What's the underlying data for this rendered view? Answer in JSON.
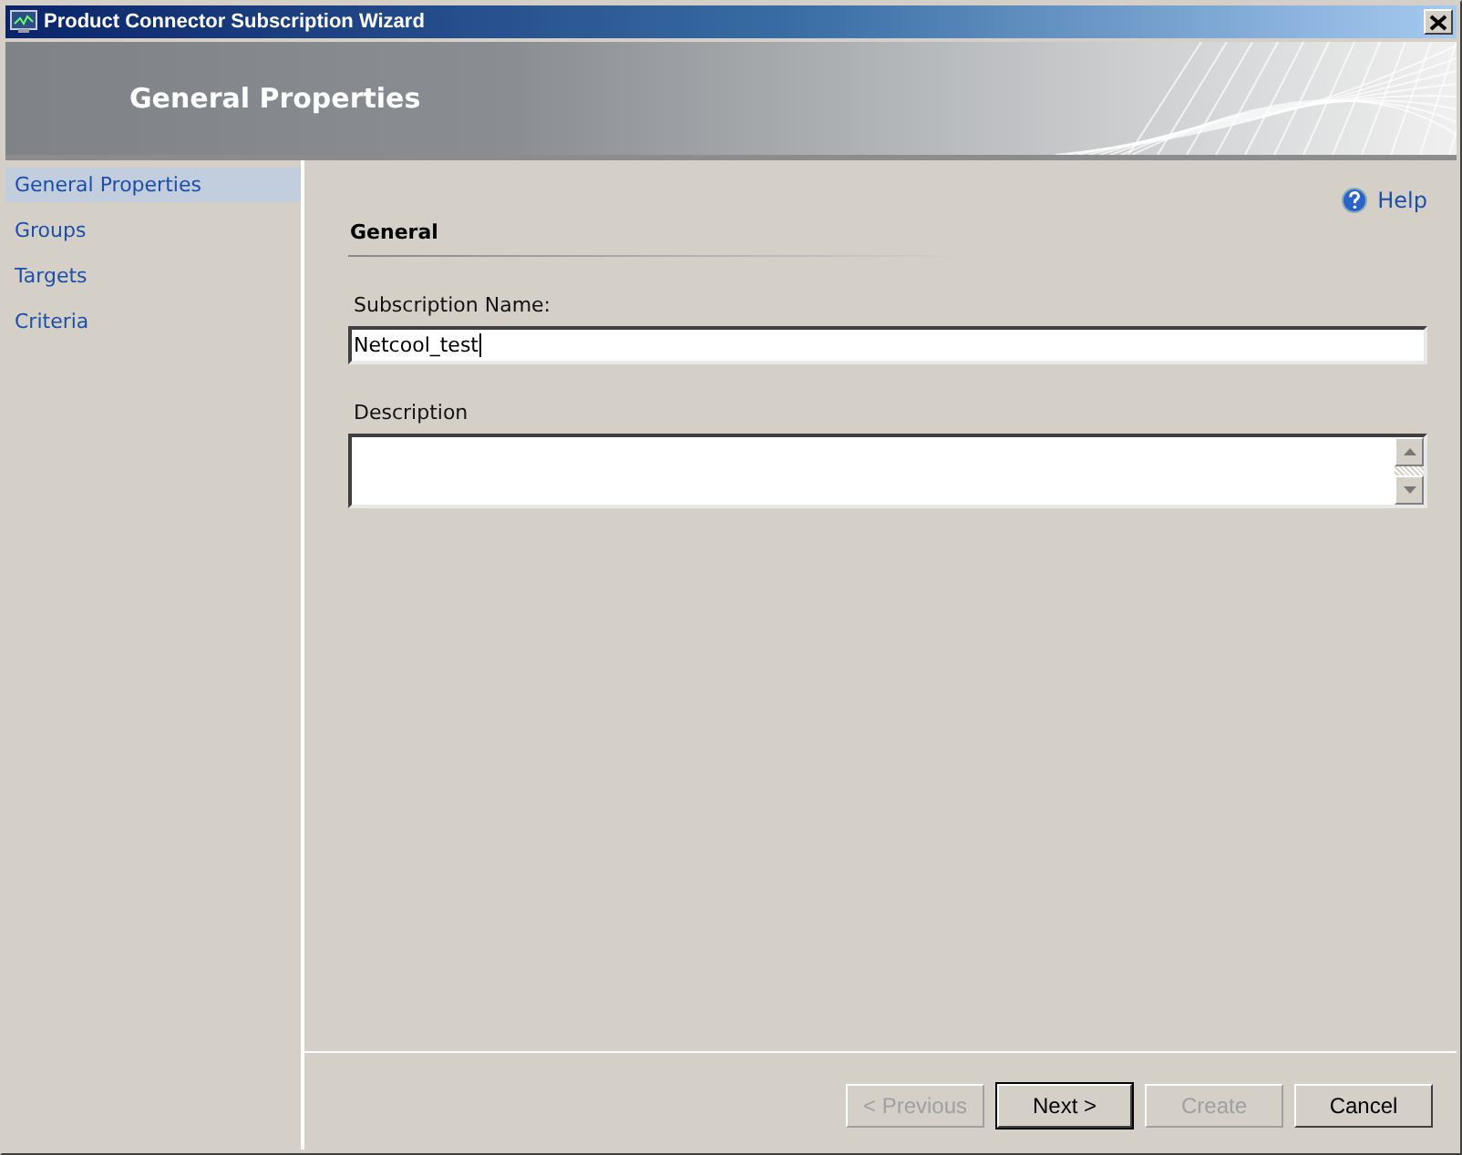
{
  "window": {
    "title": "Product Connector Subscription Wizard"
  },
  "header": {
    "title": "General Properties"
  },
  "sidebar": {
    "items": [
      {
        "label": "General Properties",
        "selected": true
      },
      {
        "label": "Groups",
        "selected": false
      },
      {
        "label": "Targets",
        "selected": false
      },
      {
        "label": "Criteria",
        "selected": false
      }
    ]
  },
  "help": {
    "label": "Help"
  },
  "section": {
    "title": "General"
  },
  "fields": [
    {
      "kind": "text",
      "label": "Subscription Name:",
      "value": "Netcool_test",
      "focused": true
    },
    {
      "kind": "textarea",
      "label": "Description"
    }
  ],
  "buttons": [
    {
      "label": "< Previous",
      "disabled": true,
      "default": false
    },
    {
      "label": "Next >",
      "disabled": false,
      "default": true
    },
    {
      "label": "Create",
      "disabled": true,
      "default": false
    },
    {
      "label": "Cancel",
      "disabled": false,
      "default": false
    }
  ]
}
